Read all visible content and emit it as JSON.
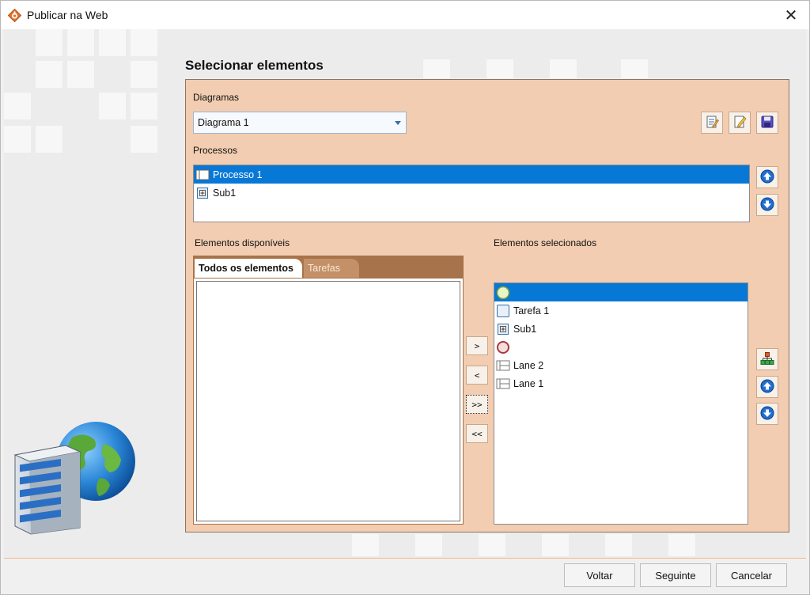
{
  "window": {
    "title": "Publicar na Web",
    "close_glyph": "✕"
  },
  "heading": "Selecionar elementos",
  "diagrams": {
    "label": "Diagramas",
    "selected": "Diagrama 1",
    "toolbar": [
      "properties-icon",
      "edit-icon",
      "save-icon"
    ]
  },
  "processes": {
    "label": "Processos",
    "items": [
      {
        "label": "Processo 1",
        "icon": "process-icon",
        "selected": true
      },
      {
        "label": "Sub1",
        "icon": "subprocess-icon",
        "selected": false
      }
    ]
  },
  "available": {
    "label": "Elementos disponíveis",
    "tabs": [
      {
        "label": "Todos os elementos",
        "active": true
      },
      {
        "label": "Tarefas",
        "active": false
      }
    ]
  },
  "selected_elements": {
    "label": "Elementos selecionados",
    "items": [
      {
        "label": "",
        "icon": "start-event-icon",
        "selected": true
      },
      {
        "label": "Tarefa 1",
        "icon": "task-icon",
        "selected": false
      },
      {
        "label": "Sub1",
        "icon": "subprocess-icon",
        "selected": false
      },
      {
        "label": "",
        "icon": "end-event-icon",
        "selected": false
      },
      {
        "label": "Lane 2",
        "icon": "lane-icon",
        "selected": false
      },
      {
        "label": "Lane 1",
        "icon": "lane-icon",
        "selected": false
      }
    ]
  },
  "move_buttons": {
    "add": ">",
    "remove": "<",
    "add_all": ">>",
    "remove_all": "<<"
  },
  "footer": {
    "back": "Voltar",
    "next": "Seguinte",
    "cancel": "Cancelar"
  },
  "colors": {
    "panel": "#f2cdb1",
    "selection": "#0878d7",
    "tab_strip": "#a7734a"
  }
}
